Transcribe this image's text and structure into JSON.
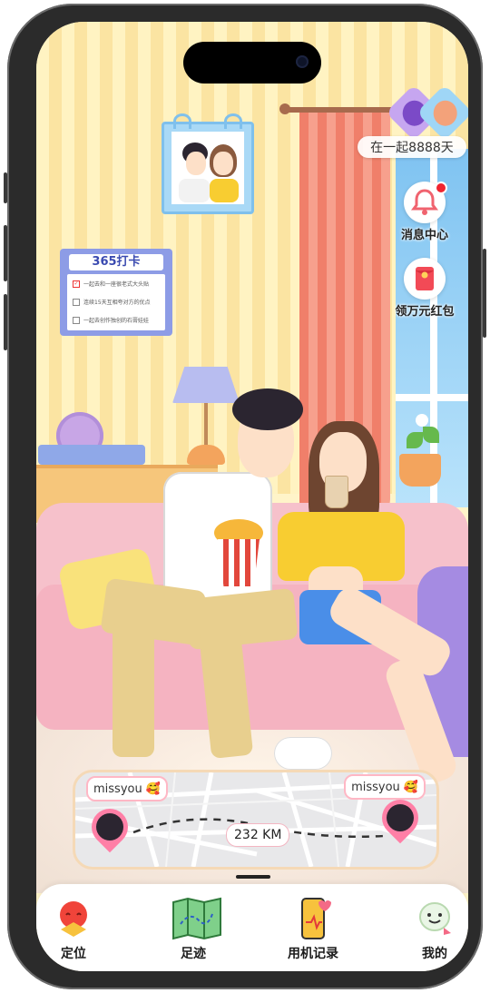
{
  "screen": {
    "title_badge": "在一起8888天"
  },
  "side_actions": [
    {
      "label": "消息中心",
      "icon": "bell-icon",
      "has_badge": true
    },
    {
      "label": "领万元红包",
      "icon": "red-envelope-icon",
      "has_badge": false
    }
  ],
  "checkin_board": {
    "title": "365打卡",
    "items": [
      {
        "text": "一起去和一座很老式大头贴",
        "checked": true
      },
      {
        "text": "连续15天互相夸对方的优点",
        "checked": false
      },
      {
        "text": "一起去创作独创的石膏娃娃",
        "checked": false
      }
    ]
  },
  "distance_card": {
    "left_name": "missyou",
    "right_name": "missyou",
    "distance": "232 KM",
    "emoji": "🥰"
  },
  "bottom_nav": [
    {
      "label": "定位",
      "icon": "location-balloon-icon"
    },
    {
      "label": "足迹",
      "icon": "map-icon"
    },
    {
      "label": "用机记录",
      "icon": "phone-heart-icon"
    },
    {
      "label": "我的",
      "icon": "smiley-avatar-icon"
    }
  ],
  "colors": {
    "wall_stripe_light": "#fff3c2",
    "wall_stripe_dark": "#fbe4a2",
    "curtain": "#f07f6a",
    "accent_pink": "#ff7fa6",
    "badge_red": "#f0242f"
  }
}
